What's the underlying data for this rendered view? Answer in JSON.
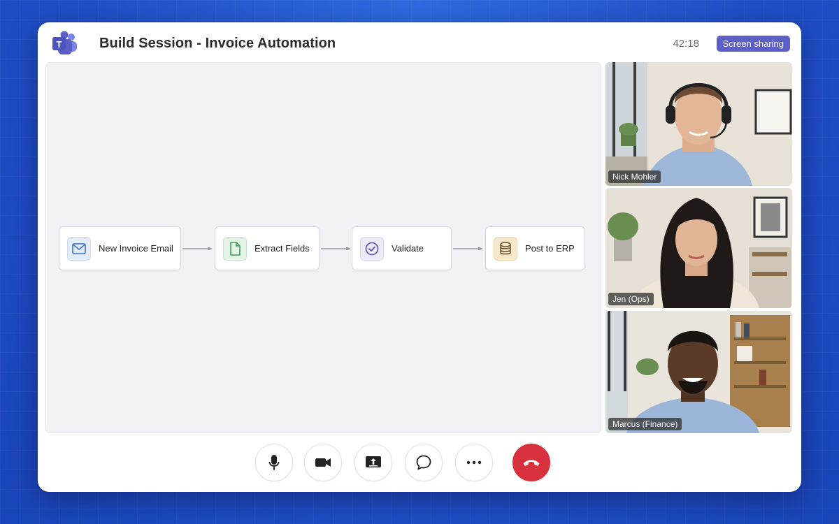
{
  "meeting": {
    "title": "Build Session - Invoice Automation",
    "elapsed": "42:18",
    "status_badge": "Screen sharing"
  },
  "workflow": {
    "steps": [
      {
        "label": "New Invoice Email",
        "icon": "mail-icon",
        "accent": "#3b6fd6",
        "tint": "#e5edfb"
      },
      {
        "label": "Extract Fields",
        "icon": "document-icon",
        "accent": "#3f9a55",
        "tint": "#e3f3e6"
      },
      {
        "label": "Validate",
        "icon": "check-circle-icon",
        "accent": "#5b4fb8",
        "tint": "#ecebf8"
      },
      {
        "label": "Post to ERP",
        "icon": "database-icon",
        "accent": "#8a6a3a",
        "tint": "#f7e7cc"
      }
    ]
  },
  "participants": [
    {
      "name": "Nick Mohler"
    },
    {
      "name": "Jen (Ops)"
    },
    {
      "name": "Marcus (Finance)"
    }
  ],
  "controls": {
    "items": [
      "microphone-icon",
      "camera-icon",
      "share-screen-icon",
      "chat-icon",
      "more-icon",
      "hang-up-icon"
    ],
    "end_call_color": "#d8303d"
  },
  "colors": {
    "brand": "#5b5fc7",
    "background": "#2458d0"
  }
}
